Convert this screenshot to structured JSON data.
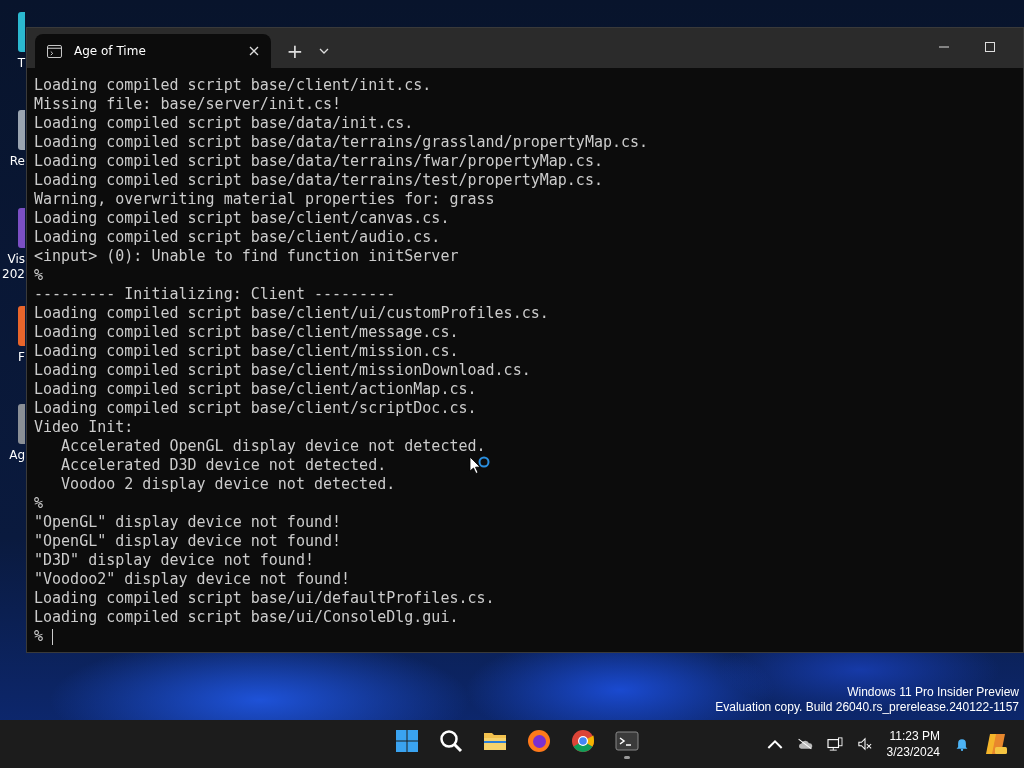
{
  "desktop_icons": [
    {
      "label": [
        "T"
      ],
      "kind": "tile"
    },
    {
      "label": [
        "Re"
      ],
      "kind": "bin"
    },
    {
      "label": [
        "Vis",
        "202"
      ],
      "kind": "studio"
    },
    {
      "label": [
        "F"
      ],
      "kind": "browser"
    },
    {
      "label": [
        "Ag"
      ],
      "kind": "app"
    }
  ],
  "window": {
    "tabs": [
      {
        "title": "Age of Time",
        "selected": true
      }
    ],
    "new_tab": "+"
  },
  "console": {
    "lines": [
      "Loading compiled script base/client/init.cs.",
      "Missing file: base/server/init.cs!",
      "Loading compiled script base/data/init.cs.",
      "Loading compiled script base/data/terrains/grassland/propertyMap.cs.",
      "Loading compiled script base/data/terrains/fwar/propertyMap.cs.",
      "Loading compiled script base/data/terrains/test/propertyMap.cs.",
      "Warning, overwriting material properties for: grass",
      "Loading compiled script base/client/canvas.cs.",
      "Loading compiled script base/client/audio.cs.",
      "<input> (0): Unable to find function initServer",
      "%",
      "--------- Initializing: Client ---------",
      "Loading compiled script base/client/ui/customProfiles.cs.",
      "Loading compiled script base/client/message.cs.",
      "Loading compiled script base/client/mission.cs.",
      "Loading compiled script base/client/missionDownload.cs.",
      "Loading compiled script base/client/actionMap.cs.",
      "Loading compiled script base/client/scriptDoc.cs.",
      "Video Init:",
      "   Accelerated OpenGL display device not detected.",
      "   Accelerated D3D device not detected.",
      "   Voodoo 2 display device not detected.",
      "%",
      "\"OpenGL\" display device not found!",
      "\"OpenGL\" display device not found!",
      "\"D3D\" display device not found!",
      "\"Voodoo2\" display device not found!",
      "Loading compiled script base/ui/defaultProfiles.cs.",
      "Loading compiled script base/ui/ConsoleDlg.gui."
    ],
    "prompt": "%"
  },
  "desktop_notice": [
    "Windows 11 Pro Insider Preview",
    "Evaluation copy. Build 26040.rs_prerelease.240122-1157"
  ],
  "taskbar": {
    "apps": [
      {
        "kind": "start",
        "running": false
      },
      {
        "kind": "search",
        "running": false
      },
      {
        "kind": "files",
        "running": false
      },
      {
        "kind": "firefox",
        "running": false
      },
      {
        "kind": "chrome",
        "running": false
      },
      {
        "kind": "terminal",
        "running": true
      }
    ],
    "time": "11:23 PM",
    "date": "3/23/2024"
  }
}
